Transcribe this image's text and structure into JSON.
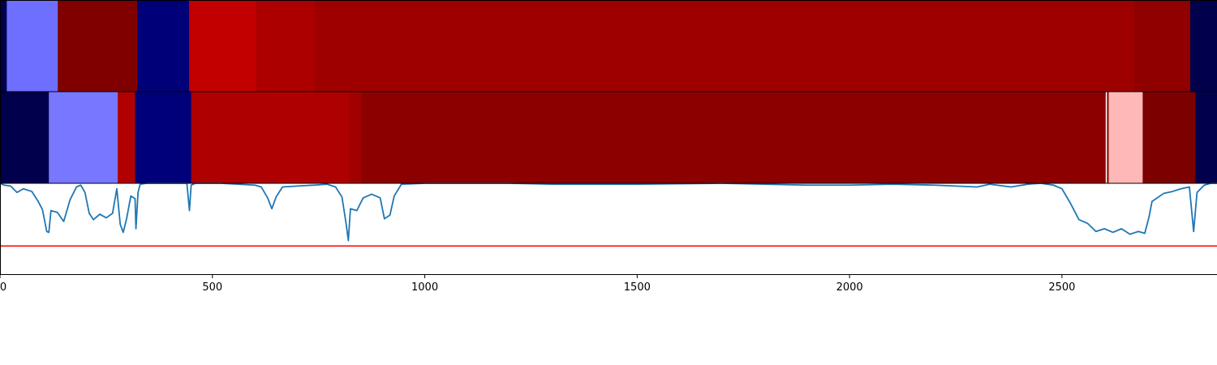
{
  "chart_data": {
    "type": "heatmap",
    "x_axis": {
      "xlim": [
        0,
        2865
      ],
      "ticks": [
        0,
        500,
        1000,
        1500,
        2000,
        2500
      ],
      "tick_labels": [
        "0",
        "500",
        "1000",
        "1500",
        "2000",
        "2500"
      ]
    },
    "tracks": [
      {
        "kind": "segments",
        "segments": [
          {
            "start": 0,
            "end": 16,
            "color": "#00004c"
          },
          {
            "start": 16,
            "end": 136,
            "color": "#6f6fff"
          },
          {
            "start": 136,
            "end": 323,
            "color": "#800000"
          },
          {
            "start": 323,
            "end": 445,
            "color": "#000078"
          },
          {
            "start": 445,
            "end": 603,
            "color": "#c20000"
          },
          {
            "start": 603,
            "end": 741,
            "color": "#ac0000"
          },
          {
            "start": 741,
            "end": 2670,
            "color": "#9e0000"
          },
          {
            "start": 2670,
            "end": 2802,
            "color": "#900000"
          },
          {
            "start": 2802,
            "end": 2865,
            "color": "#00004c"
          }
        ]
      },
      {
        "kind": "segments",
        "segments": [
          {
            "start": 0,
            "end": 115,
            "color": "#00004c"
          },
          {
            "start": 115,
            "end": 277,
            "color": "#7878ff"
          },
          {
            "start": 277,
            "end": 318,
            "color": "#b00000"
          },
          {
            "start": 318,
            "end": 450,
            "color": "#00007a"
          },
          {
            "start": 450,
            "end": 822,
            "color": "#ae0000"
          },
          {
            "start": 822,
            "end": 852,
            "color": "#a00000"
          },
          {
            "start": 852,
            "end": 2603,
            "color": "#8c0000"
          },
          {
            "start": 2603,
            "end": 2606,
            "color": "#ffffff"
          },
          {
            "start": 2606,
            "end": 2610,
            "color": "#8c0000"
          },
          {
            "start": 2610,
            "end": 2690,
            "color": "#ffb8b8"
          },
          {
            "start": 2690,
            "end": 2814,
            "color": "#7c0000"
          },
          {
            "start": 2814,
            "end": 2865,
            "color": "#00004c"
          }
        ]
      },
      {
        "kind": "line",
        "line_color": "#1f77b4",
        "threshold": 0.31,
        "threshold_color": "#ff0000",
        "ylim": [
          0,
          1
        ],
        "points": [
          [
            0,
            1.0
          ],
          [
            10,
            0.98
          ],
          [
            25,
            0.97
          ],
          [
            40,
            0.9
          ],
          [
            55,
            0.94
          ],
          [
            75,
            0.91
          ],
          [
            90,
            0.8
          ],
          [
            100,
            0.71
          ],
          [
            110,
            0.47
          ],
          [
            115,
            0.46
          ],
          [
            120,
            0.7
          ],
          [
            135,
            0.68
          ],
          [
            150,
            0.58
          ],
          [
            165,
            0.82
          ],
          [
            180,
            0.96
          ],
          [
            190,
            0.98
          ],
          [
            200,
            0.9
          ],
          [
            210,
            0.67
          ],
          [
            220,
            0.6
          ],
          [
            235,
            0.66
          ],
          [
            250,
            0.62
          ],
          [
            265,
            0.67
          ],
          [
            275,
            0.94
          ],
          [
            283,
            0.55
          ],
          [
            290,
            0.46
          ],
          [
            298,
            0.61
          ],
          [
            308,
            0.86
          ],
          [
            318,
            0.83
          ],
          [
            320,
            0.5
          ],
          [
            325,
            0.9
          ],
          [
            330,
            0.99
          ],
          [
            345,
            1.0
          ],
          [
            440,
            1.0
          ],
          [
            446,
            0.7
          ],
          [
            450,
            0.98
          ],
          [
            460,
            1.0
          ],
          [
            520,
            1.0
          ],
          [
            560,
            0.99
          ],
          [
            600,
            0.98
          ],
          [
            615,
            0.96
          ],
          [
            630,
            0.84
          ],
          [
            640,
            0.72
          ],
          [
            650,
            0.85
          ],
          [
            665,
            0.96
          ],
          [
            700,
            0.97
          ],
          [
            740,
            0.98
          ],
          [
            770,
            0.99
          ],
          [
            790,
            0.96
          ],
          [
            805,
            0.85
          ],
          [
            815,
            0.55
          ],
          [
            820,
            0.37
          ],
          [
            825,
            0.72
          ],
          [
            840,
            0.7
          ],
          [
            855,
            0.84
          ],
          [
            875,
            0.88
          ],
          [
            895,
            0.84
          ],
          [
            905,
            0.61
          ],
          [
            918,
            0.65
          ],
          [
            928,
            0.86
          ],
          [
            945,
            0.99
          ],
          [
            1000,
            1.0
          ],
          [
            1100,
            1.0
          ],
          [
            1200,
            1.0
          ],
          [
            1300,
            0.99
          ],
          [
            1500,
            0.99
          ],
          [
            1700,
            1.0
          ],
          [
            1800,
            0.99
          ],
          [
            1900,
            0.98
          ],
          [
            2000,
            0.98
          ],
          [
            2100,
            0.99
          ],
          [
            2200,
            0.98
          ],
          [
            2300,
            0.96
          ],
          [
            2330,
            0.99
          ],
          [
            2380,
            0.96
          ],
          [
            2420,
            0.99
          ],
          [
            2450,
            1.0
          ],
          [
            2480,
            0.98
          ],
          [
            2500,
            0.94
          ],
          [
            2520,
            0.78
          ],
          [
            2540,
            0.6
          ],
          [
            2560,
            0.56
          ],
          [
            2580,
            0.47
          ],
          [
            2600,
            0.5
          ],
          [
            2620,
            0.46
          ],
          [
            2640,
            0.5
          ],
          [
            2660,
            0.44
          ],
          [
            2680,
            0.47
          ],
          [
            2695,
            0.45
          ],
          [
            2705,
            0.63
          ],
          [
            2712,
            0.8
          ],
          [
            2740,
            0.89
          ],
          [
            2760,
            0.91
          ],
          [
            2780,
            0.94
          ],
          [
            2800,
            0.96
          ],
          [
            2810,
            0.47
          ],
          [
            2818,
            0.9
          ],
          [
            2835,
            0.98
          ],
          [
            2850,
            1.0
          ],
          [
            2865,
            1.0
          ]
        ]
      }
    ]
  }
}
